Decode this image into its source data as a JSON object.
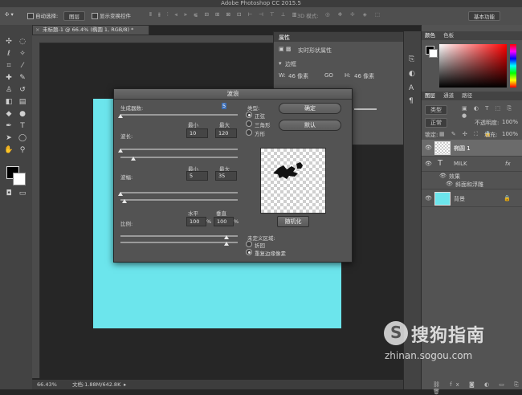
{
  "app": {
    "title": "Adobe Photoshop CC 2015.5"
  },
  "options_bar": {
    "auto_select_label": "自动选择:",
    "auto_select_value": "图层",
    "show_transform_label": "显示变换控件",
    "mode_3d": "3D 模式:",
    "workspace": "基本功能"
  },
  "document": {
    "tab": "未标题-1 @ 66.4% (椭圆 1, RGB/8) *",
    "zoom": "66.43%",
    "doc_info": "文档:1.88M/642.8K",
    "canvas_color": "#6ce5ec"
  },
  "properties": {
    "tab": "属性",
    "subtitle": "实时形状属性",
    "section": "边框",
    "w_label": "W:",
    "w_value": "46 像素",
    "link": "GO",
    "h_label": "H:",
    "h_value": "46 像素"
  },
  "color_panel": {
    "tabs": [
      "颜色",
      "色板"
    ]
  },
  "layers_panel": {
    "tabs": [
      "图层",
      "通道",
      "路径"
    ],
    "kind_filter": "类型",
    "blend_mode": "正常",
    "opacity_label": "不透明度:",
    "opacity_value": "100%",
    "lock_label": "锁定:",
    "fill_label": "填充:",
    "fill_value": "100%",
    "layers": [
      {
        "name": "椭圆 1",
        "fx": ""
      },
      {
        "name": "MILK",
        "fx": "fx"
      },
      {
        "name": "效果",
        "fx": ""
      },
      {
        "name": "斜面和浮雕",
        "fx": ""
      },
      {
        "name": "背景",
        "fx": ""
      }
    ]
  },
  "dialog": {
    "title": "波浪",
    "generators_label": "生成器数:",
    "generators_value": "5",
    "wavelength_label": "波长:",
    "min_label": "最小",
    "max_label": "最大",
    "wavelength_min": "10",
    "wavelength_max": "120",
    "amplitude_label": "波幅:",
    "amplitude_min": "5",
    "amplitude_max": "35",
    "scale_label": "比例:",
    "horizontal_label": "水平",
    "vertical_label": "垂直",
    "scale_h": "100",
    "scale_v": "100",
    "percent": "%",
    "type_label": "类型:",
    "type_options": [
      "正弦",
      "三角形",
      "方形"
    ],
    "type_selected": 0,
    "ok_label": "确定",
    "default_label": "默认",
    "randomize_label": "随机化",
    "undefined_label": "未定义区域:",
    "undefined_options": [
      "折回",
      "重复边缘像素"
    ],
    "undefined_selected": 1
  },
  "watermark": {
    "brand": "搜狗指南",
    "url": "zhinan.sogou.com"
  }
}
